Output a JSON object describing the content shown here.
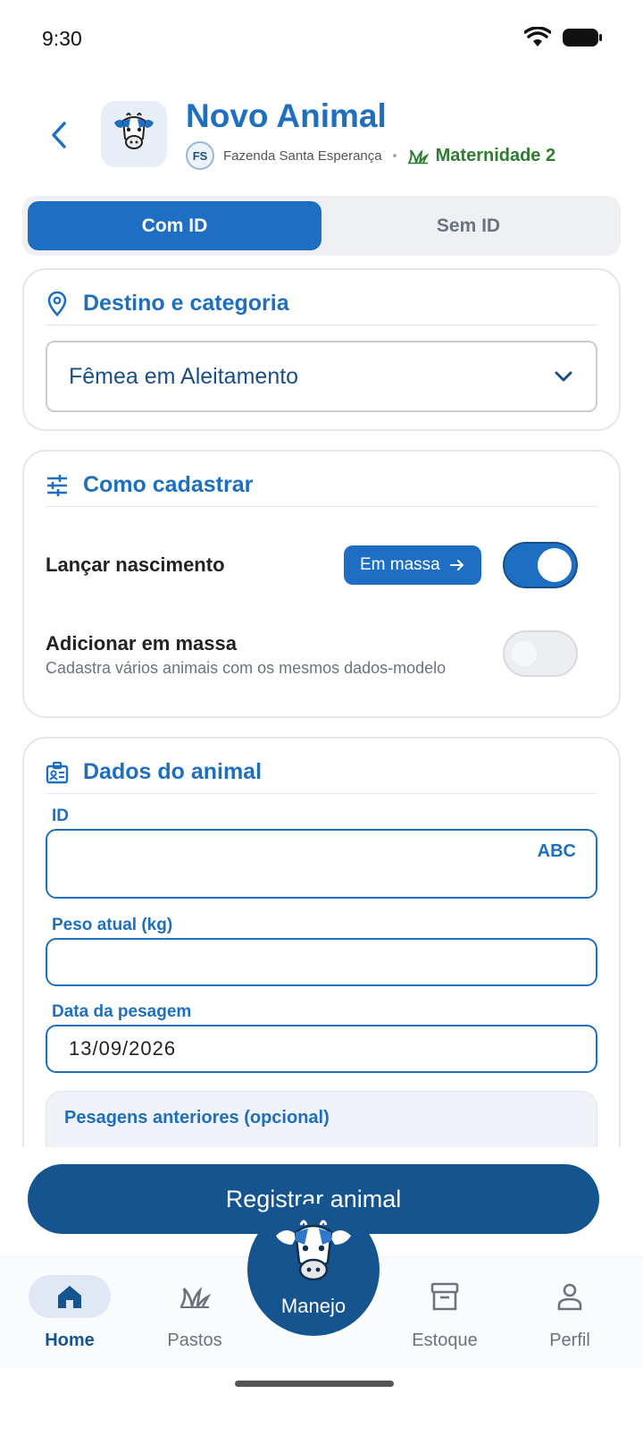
{
  "status_bar": {
    "time": "9:30"
  },
  "header": {
    "title": "Novo Animal",
    "farm_initials": "FS",
    "farm_name": "Fazenda Santa Esperança",
    "pasture_name": "Maternidade 2"
  },
  "segmented": {
    "options": [
      "Com ID",
      "Sem ID"
    ],
    "selected": "Com ID"
  },
  "destino": {
    "title": "Destino e categoria",
    "selected_category": "Fêmea em Aleitamento"
  },
  "como_cadastrar": {
    "title": "Como cadastrar",
    "lancar_label": "Lançar nascimento",
    "em_massa_button": "Em massa",
    "lancar_on": true,
    "adicionar_label": "Adicionar em massa",
    "adicionar_sub": "Cadastra vários animais com os mesmos dados-modelo",
    "adicionar_on": false
  },
  "dados": {
    "title": "Dados do animal",
    "id_label": "ID",
    "id_value": "",
    "id_keyboard_hint": "ABC",
    "peso_label": "Peso atual (kg)",
    "peso_value": "",
    "data_label": "Data da pesagem",
    "data_value": "13/09/2026",
    "pesagens_title": "Pesagens anteriores (opcional)"
  },
  "cta": {
    "label": "Registrar animal"
  },
  "bottom_nav": {
    "home": "Home",
    "pastos": "Pastos",
    "manejo": "Manejo",
    "estoque": "Estoque",
    "perfil": "Perfil",
    "active": "Home"
  },
  "colors": {
    "primary": "#1e6fc4",
    "primary_dark": "#16548f",
    "accent_green": "#2e7d32"
  }
}
